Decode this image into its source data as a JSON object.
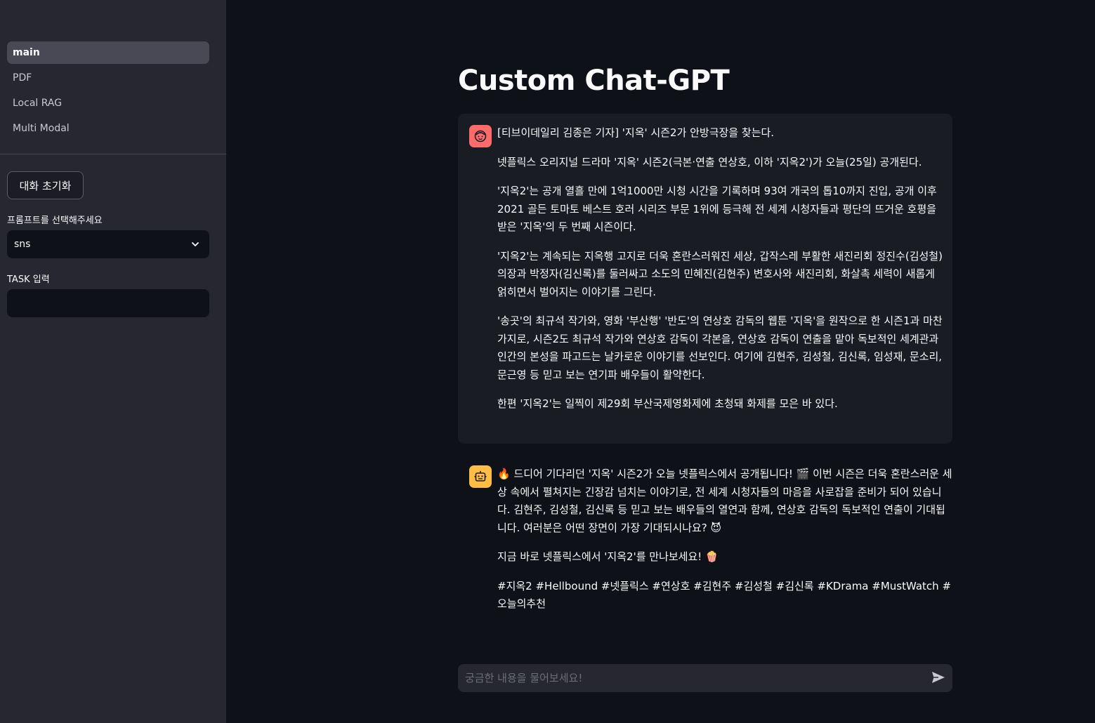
{
  "sidebar": {
    "nav": [
      {
        "label": "main",
        "active": true
      },
      {
        "label": "PDF",
        "active": false
      },
      {
        "label": "Local RAG",
        "active": false
      },
      {
        "label": "Multi Modal",
        "active": false
      }
    ],
    "reset_button": "대화 초기화",
    "prompt_label": "프롬프트를 선택해주세요",
    "prompt_selected": "sns",
    "task_label": "TASK 입력",
    "task_value": ""
  },
  "main": {
    "title": "Custom Chat-GPT",
    "user_message": [
      "[티브이데일리 김종은 기자] '지옥' 시즌2가 안방극장을 찾는다.",
      "넷플릭스 오리지널 드라마 '지옥' 시즌2(극본·연출 연상호, 이하 '지옥2')가 오늘(25일) 공개된다.",
      "'지옥2'는 공개 열흘 만에 1억1000만 시청 시간을 기록하며 93여 개국의 톱10까지 진입, 공개 이후 2021 골든 토마토 베스트 호러 시리즈 부문 1위에 등극해 전 세계 시청자들과 평단의 뜨거운 호평을 받은 '지옥'의 두 번째 시즌이다.",
      "'지옥2'는 계속되는 지옥행 고지로 더욱 혼란스러워진 세상, 갑작스레 부활한 새진리회 정진수(김성철) 의장과 박정자(김신록)를 둘러싸고 소도의 민혜진(김현주) 변호사와 새진리회, 화살촉 세력이 새롭게 얽히면서 벌어지는 이야기를 그린다.",
      "'송곳'의 최규석 작가와, 영화 '부산행' '반도'의 연상호 감독의 웹툰 '지옥'을 원작으로 한 시즌1과 마찬가지로, 시즌2도 최규석 작가와 연상호 감독이 각본을, 연상호 감독이 연출을 맡아 독보적인 세계관과 인간의 본성을 파고드는 날카로운 이야기를 선보인다. 여기에 김현주, 김성철, 김신록, 임성재, 문소리, 문근영 등 믿고 보는 연기파 배우들이 활약한다.",
      "한편 '지옥2'는 일찍이 제29회 부산국제영화제에 초청돼 화제를 모은 바 있다."
    ],
    "bot_message": [
      "🔥 드디어 기다리던 '지옥' 시즌2가 오늘 넷플릭스에서 공개됩니다! 🎬 이번 시즌은 더욱 혼란스러운 세상 속에서 펼쳐지는 긴장감 넘치는 이야기로, 전 세계 시청자들의 마음을 사로잡을 준비가 되어 있습니다. 김현주, 김성철, 김신록 등 믿고 보는 배우들의 열연과 함께, 연상호 감독의 독보적인 연출이 기대됩니다. 여러분은 어떤 장면이 가장 기대되시나요? 😈",
      "지금 바로 넷플릭스에서 '지옥2'를 만나보세요! 🍿",
      "#지옥2 #Hellbound #넷플릭스 #연상호 #김현주 #김성철 #김신록 #KDrama #MustWatch #오늘의추천"
    ],
    "chat_placeholder": "궁금한 내용을 물어보세요!"
  },
  "colors": {
    "background": "#0e1117",
    "sidebar": "#262730",
    "user_avatar": "#ff6b6b",
    "bot_avatar": "#ffbd45"
  },
  "icons": {
    "user_avatar": "face-icon",
    "bot_avatar": "robot-icon",
    "select": "chevron-down-icon",
    "send": "send-icon"
  }
}
